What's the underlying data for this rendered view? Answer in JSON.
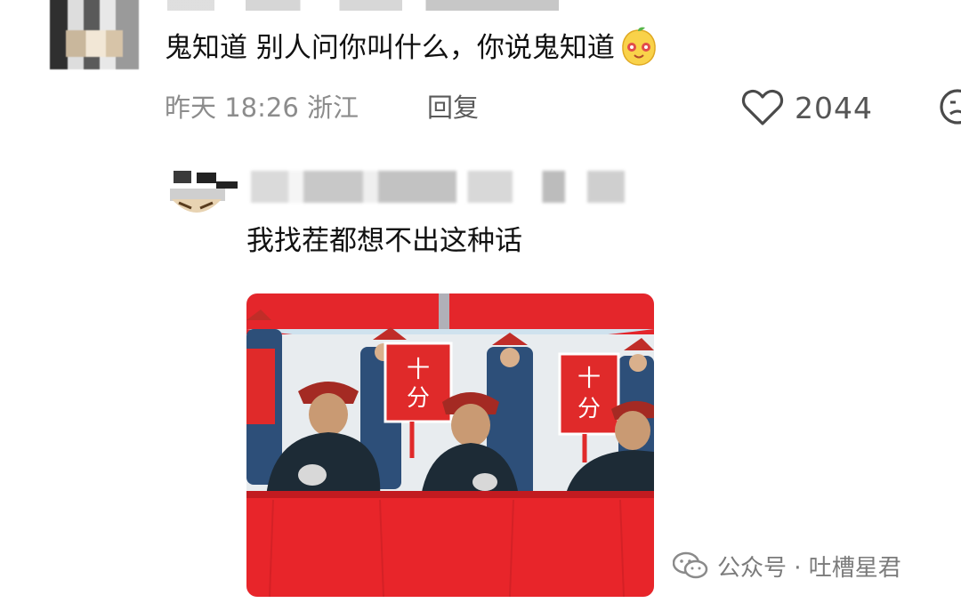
{
  "comment": {
    "text": "鬼知道 别人问你叫什么，你说鬼知道",
    "emoji_icon": "peach-face-emoji",
    "meta_text": "昨天 18:26 浙江",
    "reply_label": "回复",
    "like_count": "2044"
  },
  "reply": {
    "text": "我找茬都想不出这种话"
  },
  "attachment": {
    "sign_text_top": "十",
    "sign_text_bottom": "分"
  },
  "watermark": {
    "text": "公众号 · 吐槽星君"
  },
  "colors": {
    "meta_gray": "#8c8c8c",
    "sign_red": "#e02a2a",
    "table_red": "#e8252a"
  }
}
